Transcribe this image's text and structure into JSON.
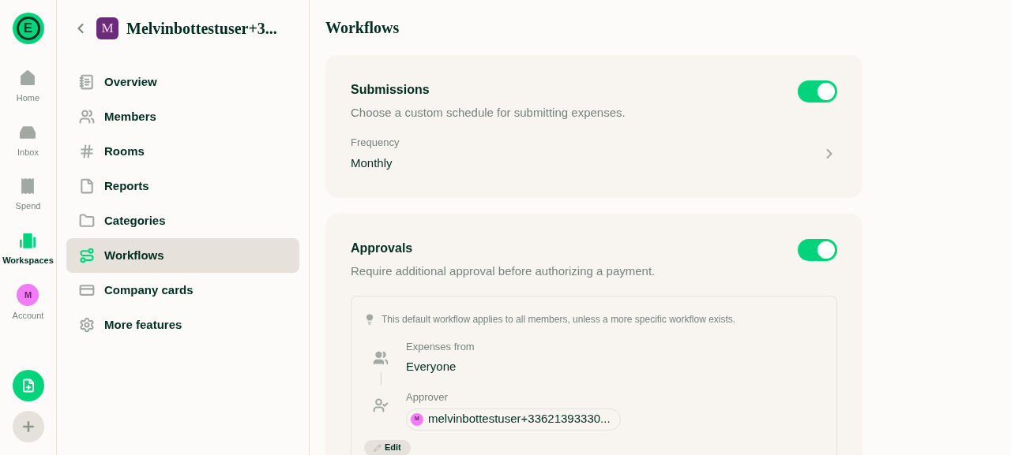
{
  "rail": {
    "logo": "E",
    "items": [
      {
        "label": "Home",
        "selected": false
      },
      {
        "label": "Inbox",
        "selected": false
      },
      {
        "label": "Spend",
        "selected": false
      },
      {
        "label": "Workspaces",
        "selected": true
      },
      {
        "label": "Account",
        "kind": "avatar",
        "avatar": "M",
        "selected": false
      }
    ]
  },
  "sidebar": {
    "workspace_avatar": "M",
    "workspace_name": "Melvinbottestuser+3...",
    "items": [
      {
        "label": "Overview",
        "selected": false
      },
      {
        "label": "Members",
        "selected": false
      },
      {
        "label": "Rooms",
        "selected": false
      },
      {
        "label": "Reports",
        "selected": false
      },
      {
        "label": "Categories",
        "selected": false
      },
      {
        "label": "Workflows",
        "selected": true
      },
      {
        "label": "Company cards",
        "selected": false
      },
      {
        "label": "More features",
        "selected": false
      }
    ]
  },
  "page_title": "Workflows",
  "submissions": {
    "title": "Submissions",
    "description": "Choose a custom schedule for submitting expenses.",
    "on": true,
    "field_label": "Frequency",
    "field_value": "Monthly"
  },
  "approvals": {
    "title": "Approvals",
    "description": "Require additional approval before authorizing a payment.",
    "on": true,
    "hint": "This default workflow applies to all members, unless a more specific workflow exists.",
    "expenses_from_label": "Expenses from",
    "expenses_from_value": "Everyone",
    "approver_label": "Approver",
    "approver_avatar": "M",
    "approver_value": "melvinbottestuser+33621393330...",
    "edit_button": "Edit"
  }
}
